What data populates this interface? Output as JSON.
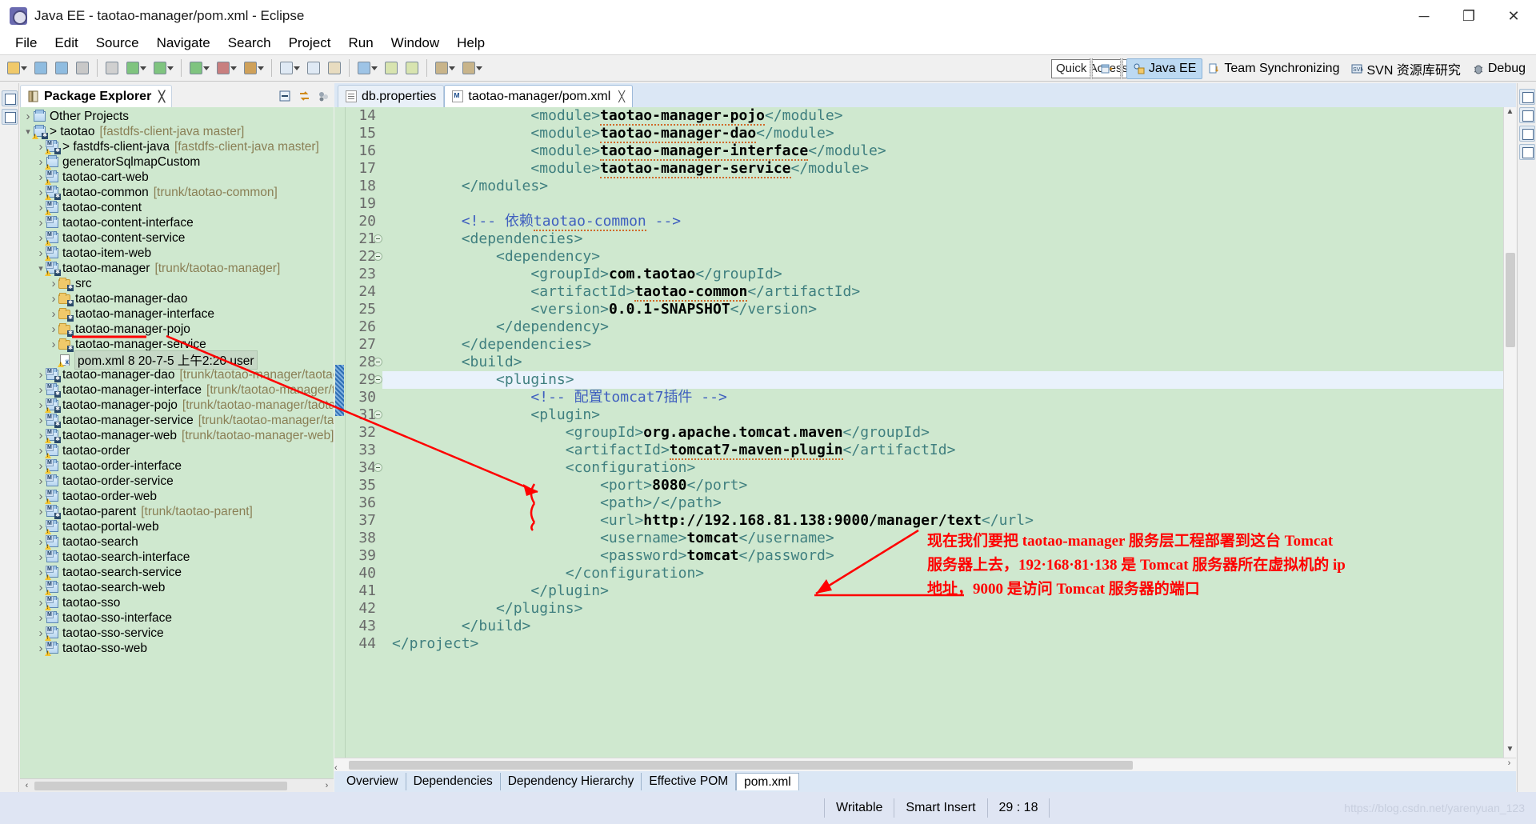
{
  "window": {
    "title": "Java EE - taotao-manager/pom.xml - Eclipse",
    "app_icon": "eclipse-icon",
    "minimize": "─",
    "maximize": "❐",
    "close": "✕"
  },
  "menu": {
    "items": [
      "File",
      "Edit",
      "Source",
      "Navigate",
      "Search",
      "Project",
      "Run",
      "Window",
      "Help"
    ]
  },
  "toolbar": {
    "quick_access_placeholder": "Quick Access",
    "perspectives": [
      {
        "label": "Java EE",
        "icon": "java-ee-perspective-icon",
        "active": true
      },
      {
        "label": "Team Synchronizing",
        "icon": "team-sync-icon",
        "active": false
      },
      {
        "label": "SVN 资源库研究",
        "icon": "svn-icon",
        "active": false
      },
      {
        "label": "Debug",
        "icon": "debug-icon",
        "active": false
      }
    ],
    "open_perspective_icon": "open-perspective-icon"
  },
  "explorer": {
    "tab_label": "Package Explorer",
    "tab_icon": "package-explorer-icon",
    "close_icon": "╳",
    "actions": [
      "collapse-all-icon",
      "link-with-editor-icon",
      "view-menu-icon"
    ],
    "tree": [
      {
        "indent": 0,
        "arrow": "closed",
        "icon": "project-icon",
        "label": "Other Projects",
        "suffix": ""
      },
      {
        "indent": 0,
        "arrow": "open",
        "icon": "project-warn-icon",
        "label": "> taotao",
        "suffix": "[fastdfs-client-java master]"
      },
      {
        "indent": 1,
        "arrow": "closed",
        "icon": "maven-project-warn-icon",
        "label": "> fastdfs-client-java",
        "suffix": "[fastdfs-client-java master]"
      },
      {
        "indent": 1,
        "arrow": "closed",
        "icon": "project-warn-icon",
        "label": "generatorSqlmapCustom",
        "suffix": ""
      },
      {
        "indent": 1,
        "arrow": "closed",
        "icon": "maven-project-warn-icon",
        "label": "taotao-cart-web",
        "suffix": ""
      },
      {
        "indent": 1,
        "arrow": "closed",
        "icon": "maven-project-warn-icon",
        "label": "taotao-common",
        "suffix": "[trunk/taotao-common]"
      },
      {
        "indent": 1,
        "arrow": "closed",
        "icon": "maven-project-warn-icon",
        "label": "taotao-content",
        "suffix": ""
      },
      {
        "indent": 1,
        "arrow": "closed",
        "icon": "maven-project-icon",
        "label": "taotao-content-interface",
        "suffix": ""
      },
      {
        "indent": 1,
        "arrow": "closed",
        "icon": "maven-project-warn-icon",
        "label": "taotao-content-service",
        "suffix": ""
      },
      {
        "indent": 1,
        "arrow": "closed",
        "icon": "maven-project-warn-icon",
        "label": "taotao-item-web",
        "suffix": ""
      },
      {
        "indent": 1,
        "arrow": "open",
        "icon": "maven-project-warn-icon",
        "label": "taotao-manager",
        "suffix": "[trunk/taotao-manager]"
      },
      {
        "indent": 2,
        "arrow": "closed",
        "icon": "folder-icon",
        "label": "src",
        "suffix": ""
      },
      {
        "indent": 2,
        "arrow": "closed",
        "icon": "folder-icon",
        "label": "taotao-manager-dao",
        "suffix": ""
      },
      {
        "indent": 2,
        "arrow": "closed",
        "icon": "folder-icon",
        "label": "taotao-manager-interface",
        "suffix": ""
      },
      {
        "indent": 2,
        "arrow": "closed",
        "icon": "folder-icon",
        "label": "taotao-manager-pojo",
        "suffix": ""
      },
      {
        "indent": 2,
        "arrow": "closed",
        "icon": "folder-icon",
        "label": "taotao-manager-service",
        "suffix": ""
      },
      {
        "indent": 2,
        "arrow": "none",
        "icon": "xml-file-icon",
        "label": "pom.xml 8  20-7-5 上午2:20  user",
        "suffix": "",
        "selected": true
      },
      {
        "indent": 1,
        "arrow": "closed",
        "icon": "maven-project-icon",
        "label": "taotao-manager-dao",
        "suffix": "[trunk/taotao-manager/taotao-ma"
      },
      {
        "indent": 1,
        "arrow": "closed",
        "icon": "maven-project-icon",
        "label": "taotao-manager-interface",
        "suffix": "[trunk/taotao-manager/taota"
      },
      {
        "indent": 1,
        "arrow": "closed",
        "icon": "maven-project-warn-icon",
        "label": "taotao-manager-pojo",
        "suffix": "[trunk/taotao-manager/taotao-m"
      },
      {
        "indent": 1,
        "arrow": "closed",
        "icon": "maven-project-icon",
        "label": "taotao-manager-service",
        "suffix": "[trunk/taotao-manager/taotao"
      },
      {
        "indent": 1,
        "arrow": "closed",
        "icon": "maven-project-warn-icon",
        "label": "taotao-manager-web",
        "suffix": "[trunk/taotao-manager-web]"
      },
      {
        "indent": 1,
        "arrow": "closed",
        "icon": "maven-project-warn-icon",
        "label": "taotao-order",
        "suffix": ""
      },
      {
        "indent": 1,
        "arrow": "closed",
        "icon": "maven-project-warn-icon",
        "label": "taotao-order-interface",
        "suffix": ""
      },
      {
        "indent": 1,
        "arrow": "closed",
        "icon": "maven-project-icon",
        "label": "taotao-order-service",
        "suffix": ""
      },
      {
        "indent": 1,
        "arrow": "closed",
        "icon": "maven-project-warn-icon",
        "label": "taotao-order-web",
        "suffix": ""
      },
      {
        "indent": 1,
        "arrow": "closed",
        "icon": "maven-project-icon",
        "label": "taotao-parent",
        "suffix": "[trunk/taotao-parent]"
      },
      {
        "indent": 1,
        "arrow": "closed",
        "icon": "maven-project-warn-icon",
        "label": "taotao-portal-web",
        "suffix": ""
      },
      {
        "indent": 1,
        "arrow": "closed",
        "icon": "maven-project-warn-icon",
        "label": "taotao-search",
        "suffix": ""
      },
      {
        "indent": 1,
        "arrow": "closed",
        "icon": "maven-project-icon",
        "label": "taotao-search-interface",
        "suffix": ""
      },
      {
        "indent": 1,
        "arrow": "closed",
        "icon": "maven-project-warn-icon",
        "label": "taotao-search-service",
        "suffix": ""
      },
      {
        "indent": 1,
        "arrow": "closed",
        "icon": "maven-project-warn-icon",
        "label": "taotao-search-web",
        "suffix": ""
      },
      {
        "indent": 1,
        "arrow": "closed",
        "icon": "maven-project-warn-icon",
        "label": "taotao-sso",
        "suffix": ""
      },
      {
        "indent": 1,
        "arrow": "closed",
        "icon": "maven-project-icon",
        "label": "taotao-sso-interface",
        "suffix": ""
      },
      {
        "indent": 1,
        "arrow": "closed",
        "icon": "maven-project-warn-icon",
        "label": "taotao-sso-service",
        "suffix": ""
      },
      {
        "indent": 1,
        "arrow": "closed",
        "icon": "maven-project-warn-icon",
        "label": "taotao-sso-web",
        "suffix": ""
      }
    ]
  },
  "editor": {
    "tabs": [
      {
        "label": "db.properties",
        "icon": "properties-file-icon",
        "active": false,
        "closable": false
      },
      {
        "label": "taotao-manager/pom.xml",
        "icon": "maven-pom-icon",
        "active": true,
        "closable": true
      }
    ],
    "first_line_number": 14,
    "current_line": 29,
    "lines": [
      {
        "n": 14,
        "fold": false,
        "current": false,
        "indent": 8,
        "segs": [
          {
            "t": "tag",
            "v": "<module>"
          },
          {
            "t": "txt-sq",
            "v": "taotao-manager-pojo"
          },
          {
            "t": "tag",
            "v": "</module>"
          }
        ]
      },
      {
        "n": 15,
        "fold": false,
        "current": false,
        "indent": 8,
        "segs": [
          {
            "t": "tag",
            "v": "<module>"
          },
          {
            "t": "txt-sq",
            "v": "taotao-manager-dao"
          },
          {
            "t": "tag",
            "v": "</module>"
          }
        ]
      },
      {
        "n": 16,
        "fold": false,
        "current": false,
        "indent": 8,
        "segs": [
          {
            "t": "tag",
            "v": "<module>"
          },
          {
            "t": "txt-sq",
            "v": "taotao-manager-interface"
          },
          {
            "t": "tag",
            "v": "</module>"
          }
        ]
      },
      {
        "n": 17,
        "fold": false,
        "current": false,
        "indent": 8,
        "segs": [
          {
            "t": "tag",
            "v": "<module>"
          },
          {
            "t": "txt-sq",
            "v": "taotao-manager-service"
          },
          {
            "t": "tag",
            "v": "</module>"
          }
        ]
      },
      {
        "n": 18,
        "fold": false,
        "current": false,
        "indent": 4,
        "segs": [
          {
            "t": "tag",
            "v": "</modules>"
          }
        ]
      },
      {
        "n": 19,
        "fold": false,
        "current": false,
        "indent": 0,
        "segs": []
      },
      {
        "n": 20,
        "fold": false,
        "current": false,
        "indent": 4,
        "segs": [
          {
            "t": "cmt",
            "v": "<!-- 依赖"
          },
          {
            "t": "cmt-sq",
            "v": "taotao-common"
          },
          {
            "t": "cmt",
            "v": " -->"
          }
        ]
      },
      {
        "n": 21,
        "fold": true,
        "current": false,
        "indent": 4,
        "segs": [
          {
            "t": "tag",
            "v": "<dependencies>"
          }
        ]
      },
      {
        "n": 22,
        "fold": true,
        "current": false,
        "indent": 6,
        "segs": [
          {
            "t": "tag",
            "v": "<dependency>"
          }
        ]
      },
      {
        "n": 23,
        "fold": false,
        "current": false,
        "indent": 8,
        "segs": [
          {
            "t": "tag",
            "v": "<groupId>"
          },
          {
            "t": "txt",
            "v": "com.taotao"
          },
          {
            "t": "tag",
            "v": "</groupId>"
          }
        ]
      },
      {
        "n": 24,
        "fold": false,
        "current": false,
        "indent": 8,
        "segs": [
          {
            "t": "tag",
            "v": "<artifactId>"
          },
          {
            "t": "txt-sq",
            "v": "taotao-common"
          },
          {
            "t": "tag",
            "v": "</artifactId>"
          }
        ]
      },
      {
        "n": 25,
        "fold": false,
        "current": false,
        "indent": 8,
        "segs": [
          {
            "t": "tag",
            "v": "<version>"
          },
          {
            "t": "txt",
            "v": "0.0.1-SNAPSHOT"
          },
          {
            "t": "tag",
            "v": "</version>"
          }
        ]
      },
      {
        "n": 26,
        "fold": false,
        "current": false,
        "indent": 6,
        "segs": [
          {
            "t": "tag",
            "v": "</dependency>"
          }
        ]
      },
      {
        "n": 27,
        "fold": false,
        "current": false,
        "indent": 4,
        "segs": [
          {
            "t": "tag",
            "v": "</dependencies>"
          }
        ]
      },
      {
        "n": 28,
        "fold": true,
        "current": false,
        "indent": 4,
        "segs": [
          {
            "t": "tag",
            "v": "<build>"
          }
        ]
      },
      {
        "n": 29,
        "fold": true,
        "current": true,
        "indent": 6,
        "segs": [
          {
            "t": "tag",
            "v": "<plugins>"
          }
        ]
      },
      {
        "n": 30,
        "fold": false,
        "current": false,
        "indent": 8,
        "segs": [
          {
            "t": "cmt",
            "v": "<!-- 配置"
          },
          {
            "t": "cmt",
            "v": "tomcat7"
          },
          {
            "t": "cmt",
            "v": "插件 -->"
          }
        ]
      },
      {
        "n": 31,
        "fold": true,
        "current": false,
        "indent": 8,
        "segs": [
          {
            "t": "tag",
            "v": "<plugin>"
          }
        ]
      },
      {
        "n": 32,
        "fold": false,
        "current": false,
        "indent": 10,
        "segs": [
          {
            "t": "tag",
            "v": "<groupId>"
          },
          {
            "t": "txt",
            "v": "org.apache.tomcat.maven"
          },
          {
            "t": "tag",
            "v": "</groupId>"
          }
        ]
      },
      {
        "n": 33,
        "fold": false,
        "current": false,
        "indent": 10,
        "segs": [
          {
            "t": "tag",
            "v": "<artifactId>"
          },
          {
            "t": "txt-sq",
            "v": "tomcat7-maven-plugin"
          },
          {
            "t": "tag",
            "v": "</artifactId>"
          }
        ]
      },
      {
        "n": 34,
        "fold": true,
        "current": false,
        "indent": 10,
        "segs": [
          {
            "t": "tag",
            "v": "<configuration>"
          }
        ]
      },
      {
        "n": 35,
        "fold": false,
        "current": false,
        "indent": 12,
        "segs": [
          {
            "t": "tag",
            "v": "<port>"
          },
          {
            "t": "txt",
            "v": "8080"
          },
          {
            "t": "tag",
            "v": "</port>"
          }
        ]
      },
      {
        "n": 36,
        "fold": false,
        "current": false,
        "indent": 12,
        "segs": [
          {
            "t": "tag",
            "v": "<path>"
          },
          {
            "t": "tag",
            "v": "/</path>"
          }
        ]
      },
      {
        "n": 37,
        "fold": false,
        "current": false,
        "indent": 12,
        "segs": [
          {
            "t": "tag",
            "v": "<url>"
          },
          {
            "t": "txt",
            "v": "http://192.168.81.138:9000/manager/text"
          },
          {
            "t": "tag",
            "v": "</url>"
          }
        ]
      },
      {
        "n": 38,
        "fold": false,
        "current": false,
        "indent": 12,
        "segs": [
          {
            "t": "tag",
            "v": "<username>"
          },
          {
            "t": "txt",
            "v": "tomcat"
          },
          {
            "t": "tag",
            "v": "</username>"
          }
        ]
      },
      {
        "n": 39,
        "fold": false,
        "current": false,
        "indent": 12,
        "segs": [
          {
            "t": "tag",
            "v": "<password>"
          },
          {
            "t": "txt",
            "v": "tomcat"
          },
          {
            "t": "tag",
            "v": "</password>"
          }
        ]
      },
      {
        "n": 40,
        "fold": false,
        "current": false,
        "indent": 10,
        "segs": [
          {
            "t": "tag",
            "v": "</configuration>"
          }
        ]
      },
      {
        "n": 41,
        "fold": false,
        "current": false,
        "indent": 8,
        "segs": [
          {
            "t": "tag",
            "v": "</plugin>"
          }
        ]
      },
      {
        "n": 42,
        "fold": false,
        "current": false,
        "indent": 6,
        "segs": [
          {
            "t": "tag",
            "v": "</plugins>"
          }
        ]
      },
      {
        "n": 43,
        "fold": false,
        "current": false,
        "indent": 4,
        "segs": [
          {
            "t": "tag",
            "v": "</build>"
          }
        ]
      },
      {
        "n": 44,
        "fold": false,
        "current": false,
        "indent": 0,
        "segs": [
          {
            "t": "tag",
            "v": "</project>"
          }
        ]
      }
    ],
    "form_tabs": [
      {
        "label": "Overview",
        "active": false
      },
      {
        "label": "Dependencies",
        "active": false
      },
      {
        "label": "Dependency Hierarchy",
        "active": false
      },
      {
        "label": "Effective POM",
        "active": false
      },
      {
        "label": "pom.xml",
        "active": true
      }
    ]
  },
  "annotations": {
    "color": "#ff0000",
    "lines": [
      "现在我们要把 taotao-manager 服务层工程部署到这台 Tomcat",
      "服务器上去，192·168·81·138 是 Tomcat 服务器所在虚拟机的 ip",
      "地址，9000 是访问 Tomcat 服务器的端口"
    ]
  },
  "status": {
    "writable": "Writable",
    "insert_mode": "Smart Insert",
    "cursor_position": "29 : 18",
    "watermark": "https://blog.csdn.net/yarenyuan_123"
  }
}
